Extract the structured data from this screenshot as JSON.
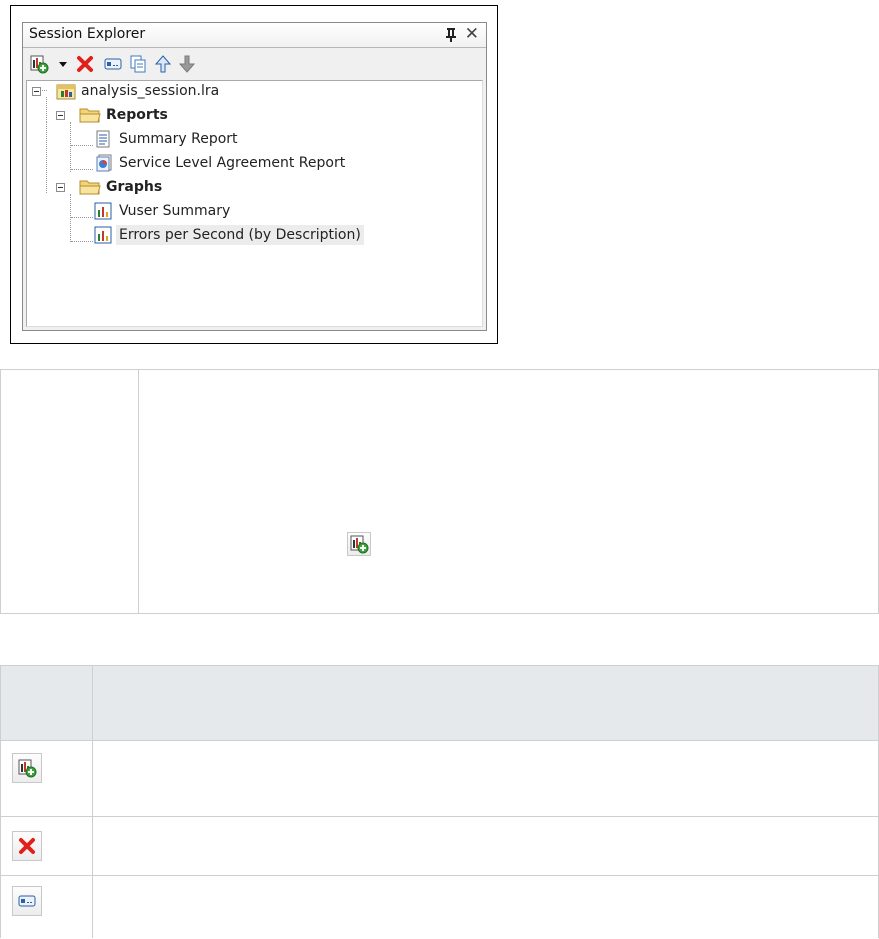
{
  "session_explorer": {
    "title": "Session Explorer",
    "toolbar": {
      "icons": [
        "add-report-graph-icon",
        "dropdown-arrow-icon",
        "delete-icon",
        "rename-icon",
        "duplicate-icon",
        "move-up-icon",
        "move-down-icon"
      ]
    },
    "tree": {
      "root": "analysis_session.lra",
      "reports_folder": "Reports",
      "reports": [
        "Summary Report",
        "Service Level Agreement Report"
      ],
      "graphs_folder": "Graphs",
      "graphs": [
        "Vuser Summary",
        "Errors per Second (by Description)"
      ]
    }
  },
  "table1": {
    "icons": [
      "add-report-graph-icon"
    ]
  },
  "table2": {
    "row_icons": [
      "add-report-graph-icon",
      "delete-icon",
      "rename-icon"
    ]
  }
}
